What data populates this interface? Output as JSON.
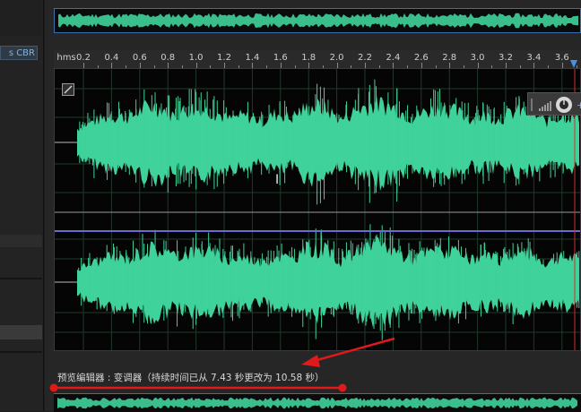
{
  "left_panel": {
    "format_chip": "s CBR"
  },
  "ruler": {
    "unit_label": "hms",
    "ticks": [
      "0.2",
      "0.4",
      "0.6",
      "0.8",
      "1.0",
      "1.2",
      "1.4",
      "1.6",
      "1.8",
      "2.0",
      "2.2",
      "2.4",
      "2.6",
      "2.8",
      "3.0",
      "3.2",
      "3.4",
      "3.6"
    ]
  },
  "status": {
    "text": "预览编辑器 : 变调器（持续时间已从 7.43 秒更改为 10.58 秒）"
  },
  "colors": {
    "waveform": "#3fd29a",
    "center_line": "#6b6bd6",
    "playhead": "#d03030",
    "annotation": "#e01a1a",
    "selection_border": "#3b6fb0"
  },
  "icons": [
    "selection-toggle-icon",
    "volume-bars-icon",
    "volume-knob-icon",
    "annotation-arrow-icon"
  ]
}
